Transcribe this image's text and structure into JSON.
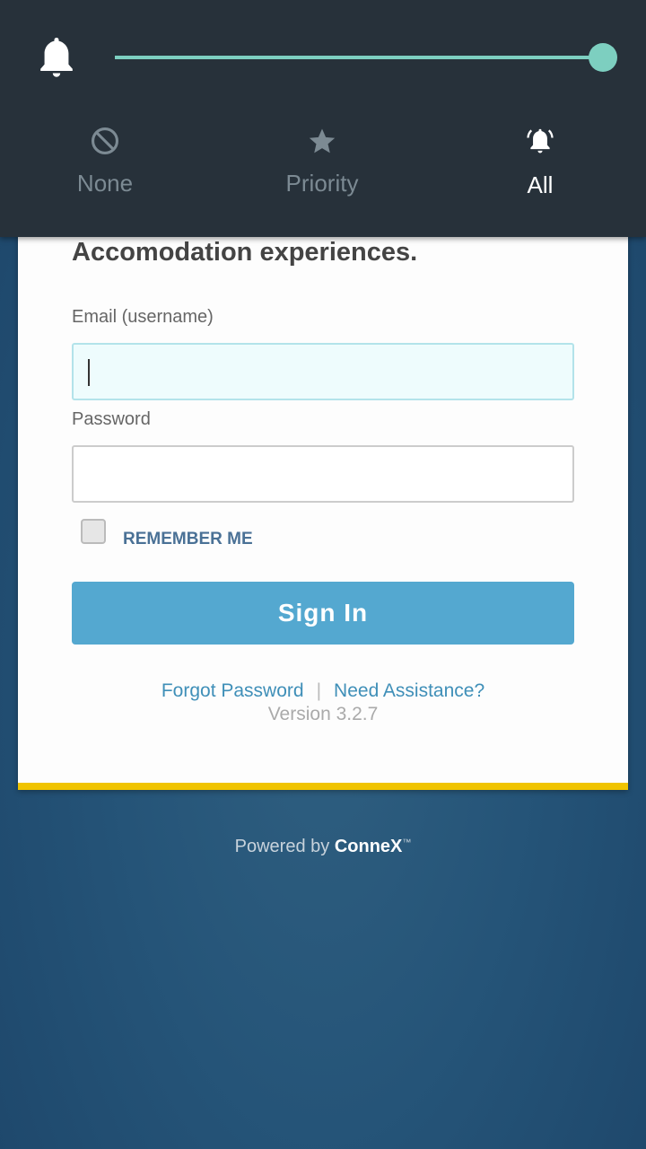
{
  "notification_panel": {
    "volume_level": 1.0,
    "accent_color": "#7dcfc0",
    "modes": [
      {
        "label": "None",
        "icon": "block-icon",
        "active": false
      },
      {
        "label": "Priority",
        "icon": "star-icon",
        "active": false
      },
      {
        "label": "All",
        "icon": "bell-ringing-icon",
        "active": true
      }
    ]
  },
  "login": {
    "heading": "Sign in to manage your Hotel Accomodation experiences.",
    "email_label": "Email (username)",
    "email_value": "",
    "password_label": "Password",
    "password_value": "",
    "remember_label": "REMEMBER ME",
    "remember_checked": false,
    "signin_label": "Sign In",
    "forgot_label": "Forgot Password",
    "separator": "|",
    "assist_label": "Need Assistance?",
    "version": "Version 3.2.7"
  },
  "footer": {
    "powered_prefix": "Powered by",
    "brand": "ConneX",
    "trademark": "™"
  },
  "colors": {
    "button": "#54a8d0",
    "link": "#3f8fb8",
    "card_border": "#f0c400"
  }
}
